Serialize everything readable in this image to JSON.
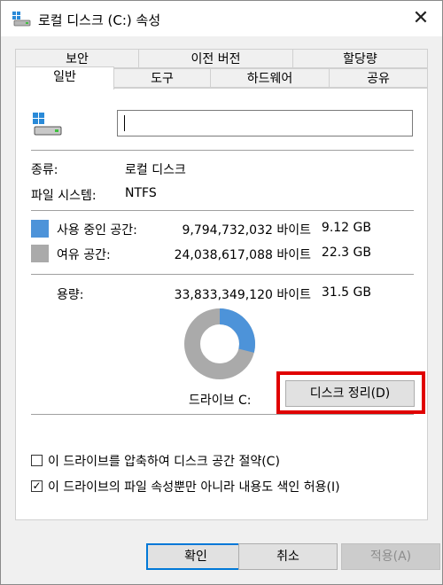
{
  "window": {
    "title": "로컬 디스크 (C:) 속성"
  },
  "tabs_row1": [
    "보안",
    "이전 버전",
    "할당량"
  ],
  "tabs_row2": [
    "일반",
    "도구",
    "하드웨어",
    "공유"
  ],
  "general": {
    "name_value": "",
    "type_label": "종류:",
    "type_value": "로컬 디스크",
    "fs_label": "파일 시스템:",
    "fs_value": "NTFS",
    "used_label": "사용 중인 공간:",
    "used_bytes": "9,794,732,032 바이트",
    "used_gb": "9.12 GB",
    "free_label": "여유 공간:",
    "free_bytes": "24,038,617,088 바이트",
    "free_gb": "22.3 GB",
    "capacity_label": "용량:",
    "capacity_bytes": "33,833,349,120 바이트",
    "capacity_gb": "31.5 GB",
    "drive_label": "드라이브 C:",
    "cleanup_button": "디스크 정리(D)",
    "compress_label": "이 드라이브를 압축하여 디스크 공간 절약(C)",
    "compress_checked": false,
    "index_label": "이 드라이브의 파일 속성뿐만 아니라 내용도 색인 허용(I)",
    "index_checked": true,
    "used_fraction": 0.2895
  },
  "footer": {
    "ok": "확인",
    "cancel": "취소",
    "apply": "적용(A)"
  },
  "colors": {
    "used": "#4d93d9",
    "free": "#aaaaaa",
    "highlight": "#e00000",
    "accent": "#0078d7"
  }
}
